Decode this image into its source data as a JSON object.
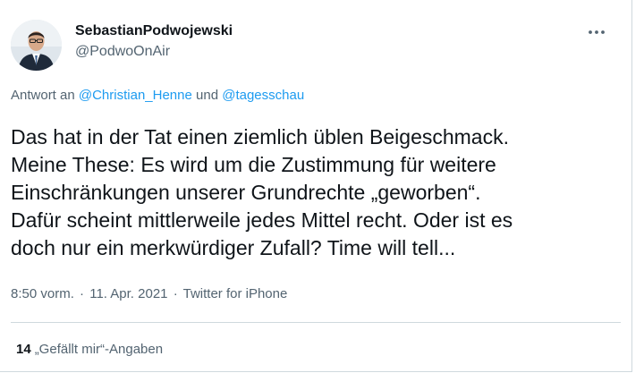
{
  "author": {
    "display_name": "SebastianPodwojewski",
    "handle": "@PodwoOnAir",
    "avatar_icon": "profile-photo"
  },
  "more_icon": "more-horizontal-icon",
  "reply_context": {
    "prefix": "Antwort an ",
    "mention_1": "@Christian_Henne",
    "conjunction": " und ",
    "mention_2": "@tagesschau"
  },
  "tweet": {
    "lines": [
      "Das hat in der Tat einen ziemlich üblen Beigeschmack.",
      "Meine These: Es wird um die Zustimmung für weitere",
      "Einschränkungen unserer Grundrechte „geworben“.",
      "Dafür scheint mittlerweile jedes Mittel recht. Oder ist es",
      "doch nur ein merkwürdiger Zufall? Time will tell..."
    ]
  },
  "meta": {
    "time": "8:50 vorm.",
    "separator": "·",
    "date": "11. Apr. 2021",
    "source": "Twitter for iPhone"
  },
  "stats": {
    "likes_count": "14",
    "likes_label": "„Gefällt mir“-Angaben"
  },
  "colors": {
    "link": "#1d9bf0",
    "secondary_text": "#536471",
    "primary_text": "#0f1419",
    "border": "#cfd9de"
  }
}
